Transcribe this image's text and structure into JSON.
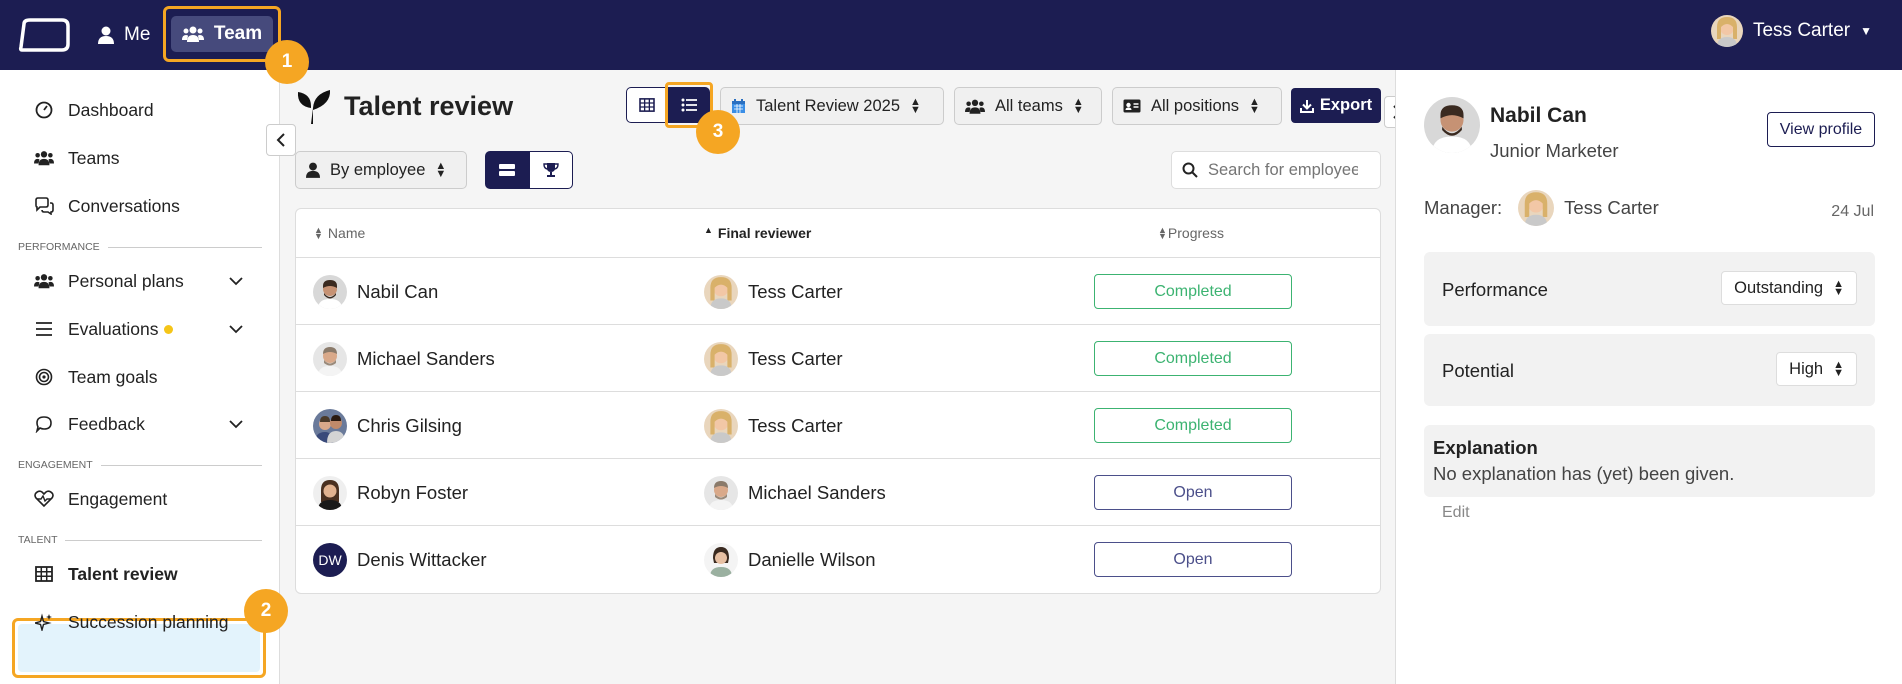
{
  "topbar": {
    "nav_me": "Me",
    "nav_team": "Team",
    "user_name": "Tess Carter"
  },
  "badges": {
    "b1": "1",
    "b2": "2",
    "b3": "3"
  },
  "sidebar": {
    "items": {
      "dashboard": "Dashboard",
      "teams": "Teams",
      "conversations": "Conversations",
      "personal_plans": "Personal plans",
      "evaluations": "Evaluations",
      "team_goals": "Team goals",
      "feedback": "Feedback",
      "engagement": "Engagement",
      "talent_review": "Talent review",
      "succession": "Succession planning"
    },
    "sections": {
      "performance": "PERFORMANCE",
      "engagement": "ENGAGEMENT",
      "talent": "TALENT"
    }
  },
  "main": {
    "title": "Talent review",
    "filters": {
      "cycle": "Talent Review 2025",
      "teams": "All teams",
      "positions": "All positions"
    },
    "export_label": "Export",
    "group_by": "By employee",
    "search_placeholder": "Search for employee"
  },
  "table": {
    "columns": {
      "name": "Name",
      "reviewer": "Final reviewer",
      "progress": "Progress"
    },
    "rows": [
      {
        "name": "Nabil Can",
        "reviewer": "Tess Carter",
        "progress": "Completed"
      },
      {
        "name": "Michael Sanders",
        "reviewer": "Tess Carter",
        "progress": "Completed"
      },
      {
        "name": "Chris Gilsing",
        "reviewer": "Tess Carter",
        "progress": "Completed"
      },
      {
        "name": "Robyn Foster",
        "reviewer": "Michael Sanders",
        "progress": "Open"
      },
      {
        "name": "Denis Wittacker",
        "initials": "DW",
        "reviewer": "Danielle Wilson",
        "progress": "Open"
      }
    ]
  },
  "panel": {
    "name": "Nabil Can",
    "role": "Junior Marketer",
    "view_profile": "View profile",
    "manager_label": "Manager:",
    "manager_name": "Tess Carter",
    "date": "24 Jul",
    "performance_label": "Performance",
    "performance_value": "Outstanding",
    "potential_label": "Potential",
    "potential_value": "High",
    "explanation_title": "Explanation",
    "explanation_text": "No explanation has (yet) been given.",
    "edit_label": "Edit"
  },
  "colors": {
    "navy": "#1c1d52",
    "highlight": "#f5a623",
    "completed": "#3cb371",
    "open": "#4b4f8a"
  }
}
